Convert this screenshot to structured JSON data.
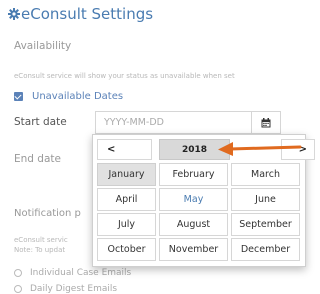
{
  "page": {
    "title": "eConsult Settings",
    "section_label": "Availability",
    "help_text": "eConsult service will show your status as unavailable when set"
  },
  "unavailable": {
    "label": "Unavailable Dates",
    "checked": true
  },
  "start_date": {
    "label": "Start date",
    "placeholder": "YYYY-MM-DD"
  },
  "end_date": {
    "label": "End date"
  },
  "notifications": {
    "label": "Notification p",
    "help_line_1": "eConsult servic",
    "help_line_2": "Note: To updat",
    "options": [
      "Individual Case Emails",
      "Daily Digest Emails"
    ]
  },
  "picker": {
    "prev": "<",
    "next": ">",
    "year": "2018",
    "selected_month": "January",
    "current_month": "May",
    "months": [
      [
        "January",
        "February",
        "March"
      ],
      [
        "April",
        "May",
        "June"
      ],
      [
        "July",
        "August",
        "September"
      ],
      [
        "October",
        "November",
        "December"
      ]
    ]
  },
  "colors": {
    "accent": "#4a7cb1",
    "annotation_arrow": "#e06a1f",
    "selected_cell": "#e1e1e1",
    "year_header": "#d9d9d9"
  },
  "icons": {
    "title": "gear-icon",
    "calendar": "calendar-icon",
    "annotation": "arrow-left-icon"
  }
}
